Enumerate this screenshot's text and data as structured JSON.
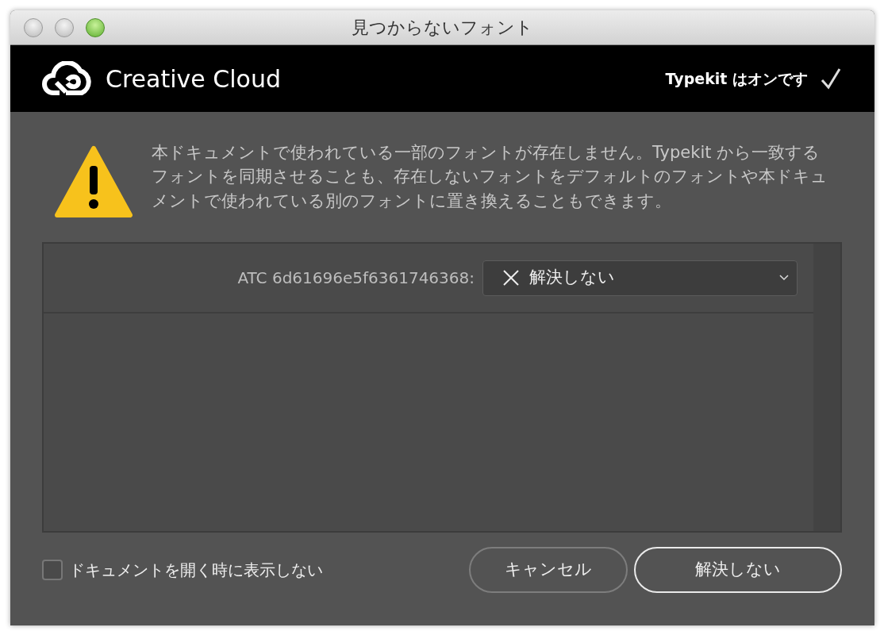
{
  "window": {
    "title": "見つからないフォント"
  },
  "header": {
    "brand": "Creative Cloud",
    "typekit_status": "Typekit はオンです",
    "typekit_on": true
  },
  "message": "本ドキュメントで使われている一部のフォントが存在しません。Typekit から一致するフォントを同期させることも、存在しないフォントをデフォルトのフォントや本ドキュメントで使われている別のフォントに置き換えることもできます。",
  "fonts": [
    {
      "name": "ATC 6d61696e5f6361746368:",
      "replacement": "解決しない"
    }
  ],
  "dont_show": {
    "label": "ドキュメントを開く時に表示しない",
    "checked": false
  },
  "buttons": [
    {
      "label": "キャンセル",
      "default": false
    },
    {
      "label": "解決しない",
      "default": true
    }
  ]
}
